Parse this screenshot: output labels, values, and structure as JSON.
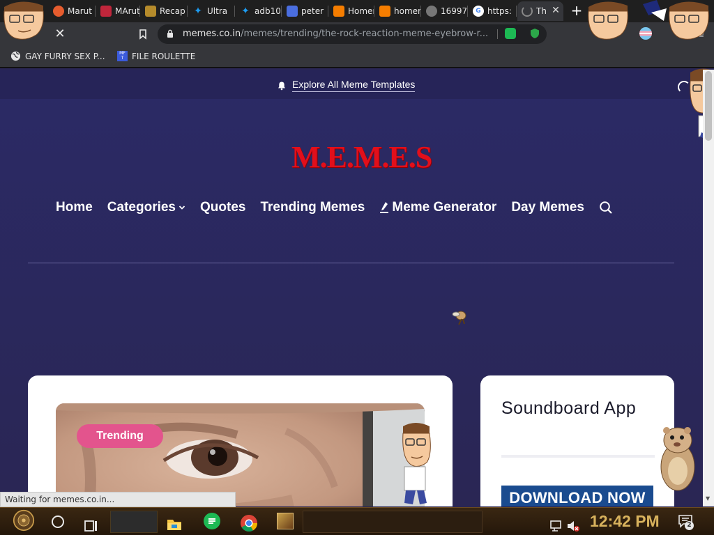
{
  "browser": {
    "tabs": [
      {
        "title": "Marut",
        "icon": "chrome-icon",
        "color": "#e65c2e"
      },
      {
        "title": "MArut",
        "icon": "et-icon",
        "color": "#c0263b"
      },
      {
        "title": "Recap",
        "icon": "p-icon",
        "color": "#b58b2b"
      },
      {
        "title": "Ultra",
        "icon": "twitter-icon",
        "color": "#1d9bf0"
      },
      {
        "title": "adb10",
        "icon": "twitter-icon",
        "color": "#1d9bf0"
      },
      {
        "title": "peter",
        "icon": "q-icon",
        "color": "#4a6ee0"
      },
      {
        "title": "Homer",
        "icon": "blogger-icon",
        "color": "#f57d00"
      },
      {
        "title": "homer",
        "icon": "blogger-icon",
        "color": "#f57d00"
      },
      {
        "title": "16997",
        "icon": "globe-icon",
        "color": "#777777"
      },
      {
        "title": "https:",
        "icon": "google-icon",
        "color": "#ffffff"
      },
      {
        "title": "Th",
        "icon": "loading-icon",
        "color": "#888888"
      }
    ],
    "url_host": "memes.co.in",
    "url_path": "/memes/trending/the-rock-reaction-meme-eyebrow-r...",
    "bookmarks": [
      {
        "label": "GAY FURRY SEX P...",
        "icon": "globe-icon"
      },
      {
        "label": "FILE ROULETTE",
        "icon": "mft-icon"
      }
    ],
    "status_text": "Waiting for memes.co.in..."
  },
  "site": {
    "explore_link": "Explore All Meme Templates",
    "logo_text": "M.E.M.E.S",
    "nav": [
      {
        "label": "Home",
        "icon": null
      },
      {
        "label": "Categories",
        "icon": "chevron-down-icon"
      },
      {
        "label": "Quotes",
        "icon": null
      },
      {
        "label": "Trending Memes",
        "icon": null
      },
      {
        "label": "Meme Generator",
        "icon": "pen-icon"
      },
      {
        "label": "Day Memes",
        "icon": null
      }
    ],
    "trending_badge": "Trending",
    "sidebar": {
      "title": "Soundboard App",
      "download_label": "DOWNLOAD NOW"
    },
    "colors": {
      "background": "#2a2654",
      "logo": "#e20f1b",
      "badge": "#e3548d",
      "download": "#1a4b8f"
    }
  },
  "taskbar": {
    "clock": "12:42 PM",
    "notification_count": "2"
  }
}
